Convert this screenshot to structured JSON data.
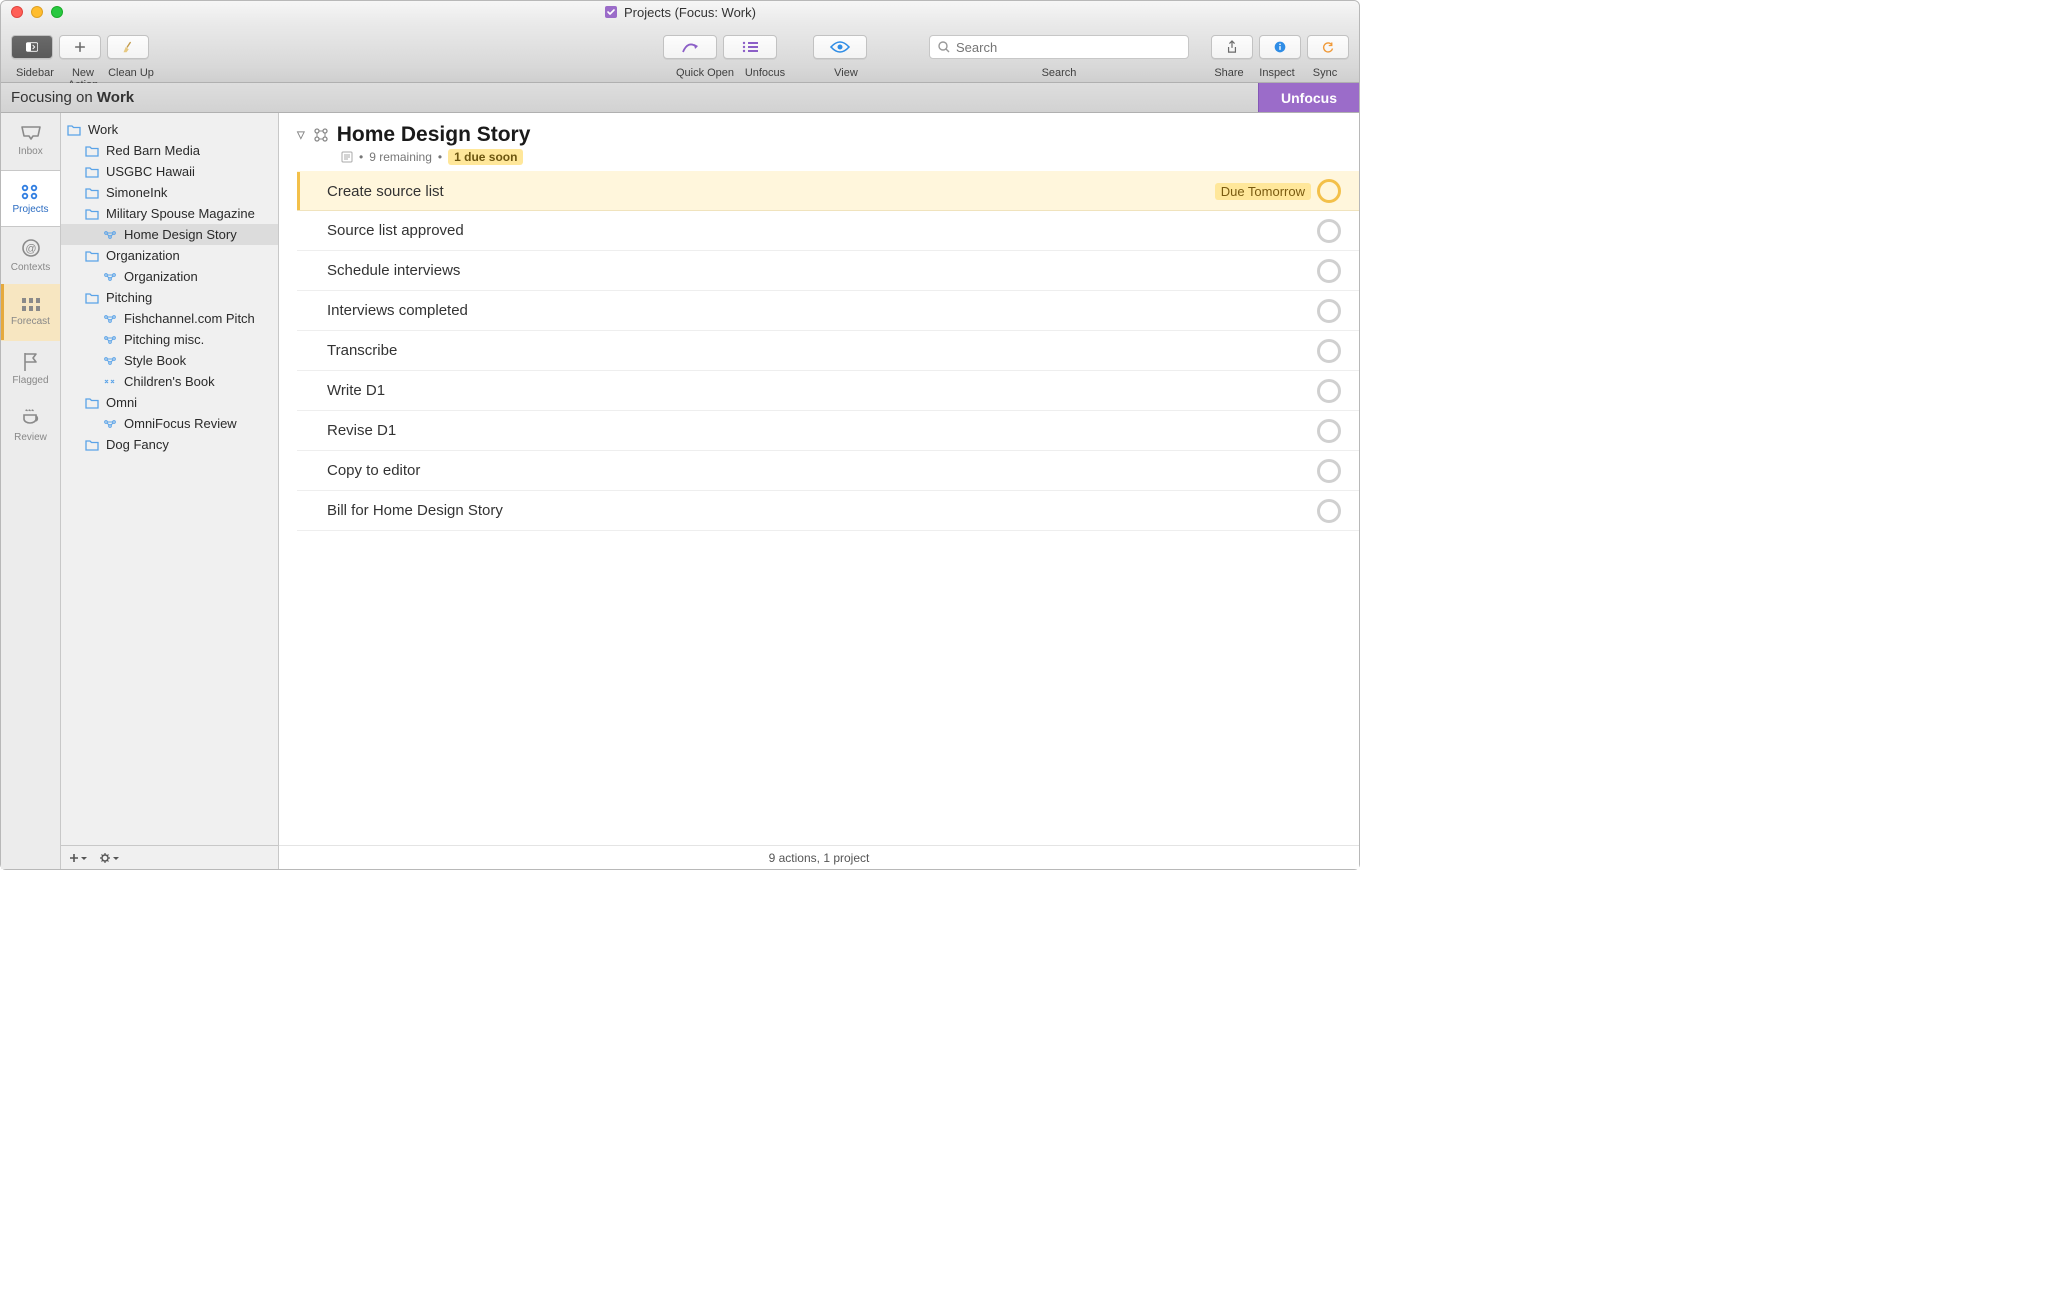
{
  "window": {
    "title": "Projects (Focus: Work)"
  },
  "toolbar": {
    "sidebar": "Sidebar",
    "new_action": "New Action",
    "clean_up": "Clean Up",
    "quick_open": "Quick Open",
    "unfocus": "Unfocus",
    "view": "View",
    "search_label": "Search",
    "search_placeholder": "Search",
    "share": "Share",
    "inspect": "Inspect",
    "sync": "Sync"
  },
  "focusbar": {
    "prefix": "Focusing on ",
    "focus_name": "Work",
    "unfocus_btn": "Unfocus"
  },
  "perspectives": [
    {
      "id": "inbox",
      "label": "Inbox"
    },
    {
      "id": "projects",
      "label": "Projects"
    },
    {
      "id": "contexts",
      "label": "Contexts"
    },
    {
      "id": "forecast",
      "label": "Forecast"
    },
    {
      "id": "flagged",
      "label": "Flagged"
    },
    {
      "id": "review",
      "label": "Review"
    }
  ],
  "tree": {
    "root": {
      "label": "Work"
    },
    "items": [
      {
        "label": "Red Barn Media",
        "type": "folder",
        "indent": 1
      },
      {
        "label": "USGBC Hawaii",
        "type": "folder",
        "indent": 1
      },
      {
        "label": "SimoneInk",
        "type": "folder",
        "indent": 1
      },
      {
        "label": "Military Spouse Magazine",
        "type": "folder",
        "indent": 1
      },
      {
        "label": "Home Design Story",
        "type": "project",
        "indent": 2,
        "selected": true
      },
      {
        "label": "Organization",
        "type": "folder",
        "indent": 1
      },
      {
        "label": "Organization",
        "type": "project",
        "indent": 2
      },
      {
        "label": "Pitching",
        "type": "folder",
        "indent": 1
      },
      {
        "label": "Fishchannel.com Pitch",
        "type": "project",
        "indent": 2
      },
      {
        "label": "Pitching misc.",
        "type": "project",
        "indent": 2
      },
      {
        "label": "Style Book",
        "type": "project",
        "indent": 2
      },
      {
        "label": "Children's Book",
        "type": "project-alt",
        "indent": 2
      },
      {
        "label": "Omni",
        "type": "folder",
        "indent": 1
      },
      {
        "label": "OmniFocus Review",
        "type": "project",
        "indent": 2
      },
      {
        "label": "Dog Fancy",
        "type": "folder",
        "indent": 1
      }
    ]
  },
  "content": {
    "title": "Home Design Story",
    "remaining": "9 remaining",
    "due_soon": "1 due soon",
    "tasks": [
      {
        "title": "Create source list",
        "due": "Due Tomorrow",
        "due_soon": true
      },
      {
        "title": "Source list approved"
      },
      {
        "title": "Schedule interviews"
      },
      {
        "title": "Interviews completed"
      },
      {
        "title": "Transcribe"
      },
      {
        "title": "Write D1"
      },
      {
        "title": "Revise D1"
      },
      {
        "title": "Copy to editor"
      },
      {
        "title": "Bill for Home Design Story"
      }
    ],
    "footer": "9 actions, 1 project"
  }
}
